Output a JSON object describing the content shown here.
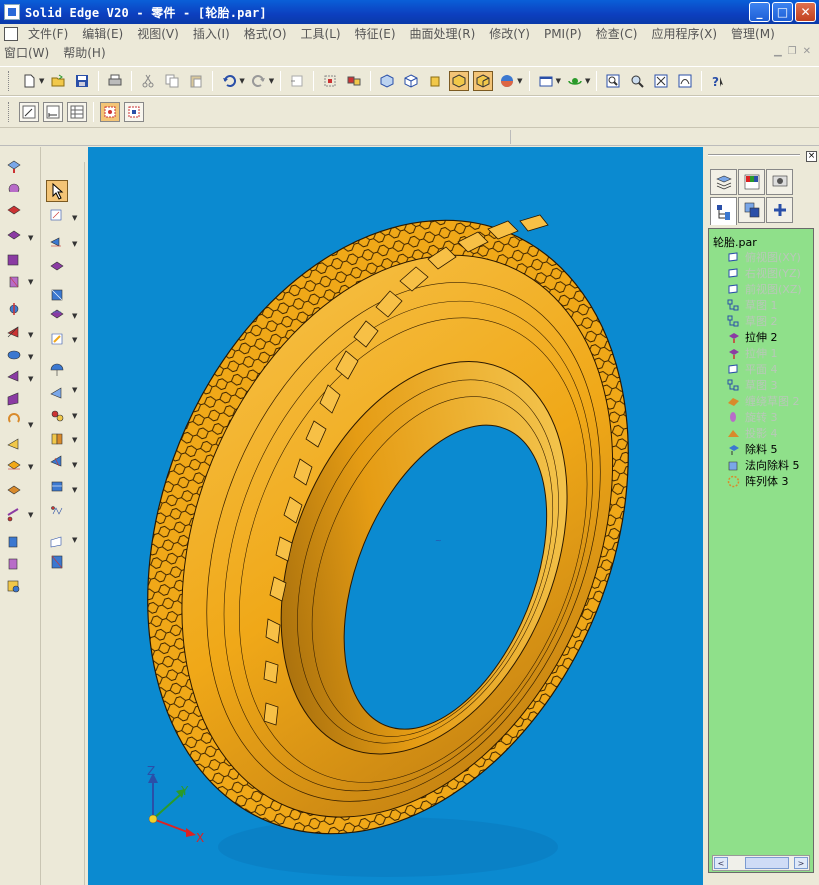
{
  "window": {
    "title": "Solid Edge V20 - 零件 - [轮胎.par]",
    "minimize_label": "_",
    "maximize_label": "□",
    "close_label": "✕"
  },
  "menus": {
    "row1": [
      "文件(F)",
      "编辑(E)",
      "视图(V)",
      "插入(I)",
      "格式(O)",
      "工具(L)",
      "特征(E)",
      "曲面处理(R)",
      "修改(Y)",
      "PMI(P)",
      "检查(C)",
      "应用程序(X)",
      "管理(M)"
    ],
    "row2": [
      "窗口(W)",
      "帮助(H)"
    ]
  },
  "viewport": {
    "background": "#0b8ad0",
    "model_color": "#f0a818",
    "axis": {
      "z": "Z",
      "y": "Y",
      "x": "X"
    }
  },
  "feature_tree": {
    "background": "#8fe08a",
    "root": "轮胎.par",
    "items": [
      {
        "label": "俯视图(XY)",
        "state": "dim",
        "icon": "plane-icon"
      },
      {
        "label": "右视图(YZ)",
        "state": "dim",
        "icon": "plane-icon"
      },
      {
        "label": "前视图(XZ)",
        "state": "dim",
        "icon": "plane-icon"
      },
      {
        "label": "草图 1",
        "state": "dim",
        "icon": "sketch-icon"
      },
      {
        "label": "草图 2",
        "state": "dim",
        "icon": "sketch-icon"
      },
      {
        "label": "拉伸 2",
        "state": "active",
        "icon": "extrude-icon"
      },
      {
        "label": "拉伸 1",
        "state": "dim",
        "icon": "extrude-icon"
      },
      {
        "label": "平面 4",
        "state": "dim",
        "icon": "plane-icon"
      },
      {
        "label": "草图 3",
        "state": "dim",
        "icon": "sketch-icon"
      },
      {
        "label": "缠绕草图 2",
        "state": "dim",
        "icon": "wrap-sketch-icon"
      },
      {
        "label": "旋转 3",
        "state": "dim",
        "icon": "revolve-icon"
      },
      {
        "label": "投影 4",
        "state": "dim",
        "icon": "project-icon"
      },
      {
        "label": "除料 5",
        "state": "active",
        "icon": "cutout-icon"
      },
      {
        "label": "法向除料 5",
        "state": "active",
        "icon": "normal-cutout-icon"
      },
      {
        "label": "阵列体 3",
        "state": "active",
        "icon": "pattern-icon"
      }
    ]
  },
  "scrollbar": {
    "left_arrow": "<",
    "right_arrow": ">"
  }
}
